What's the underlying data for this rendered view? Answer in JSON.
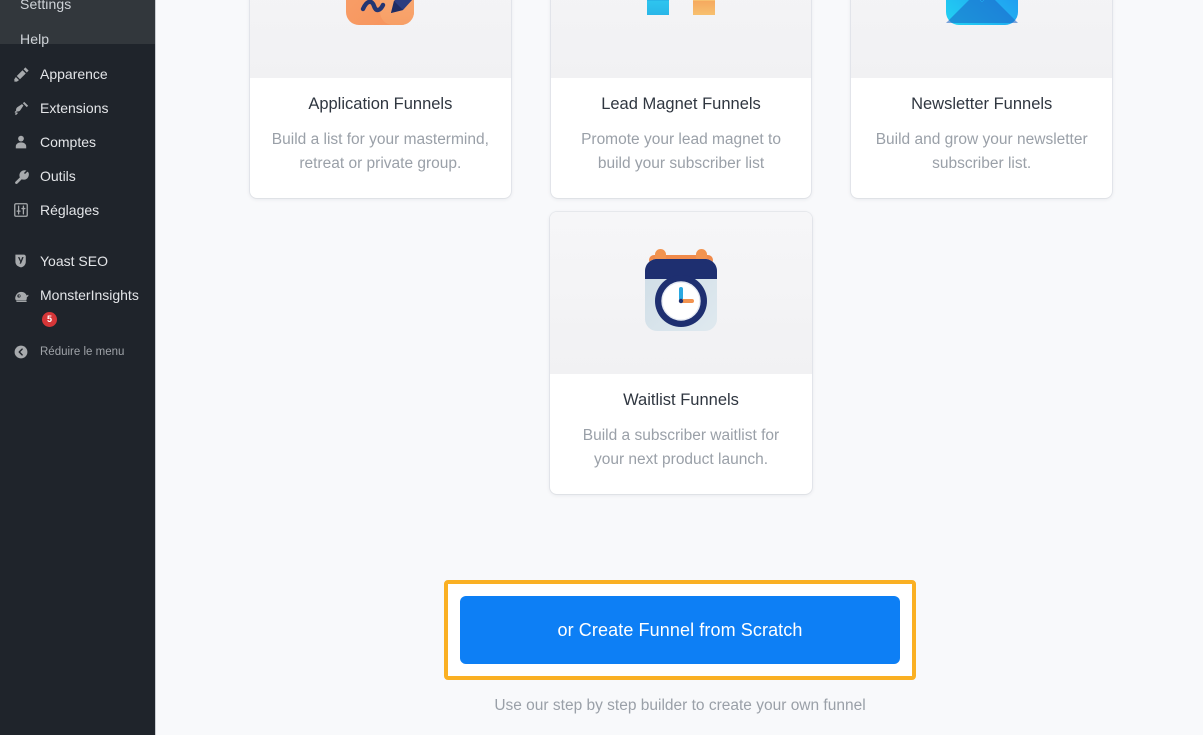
{
  "sidebar": {
    "submenu": [
      {
        "label": "Settings",
        "icon": "none"
      },
      {
        "label": "Help",
        "icon": "none"
      }
    ],
    "items": [
      {
        "label": "Apparence",
        "icon": "paintbrush-icon"
      },
      {
        "label": "Extensions",
        "icon": "plug-icon"
      },
      {
        "label": "Comptes",
        "icon": "user-icon"
      },
      {
        "label": "Outils",
        "icon": "wrench-icon"
      },
      {
        "label": "Réglages",
        "icon": "sliders-icon"
      }
    ],
    "plugins": [
      {
        "label": "Yoast SEO",
        "icon": "yoast-icon",
        "badge": ""
      },
      {
        "label": "MonsterInsights",
        "icon": "monsterinsights-icon",
        "badge": "5"
      }
    ],
    "collapse": {
      "label": "Réduire le menu",
      "icon": "chevron-left-circle-icon"
    },
    "colors": {
      "background": "#1f242b",
      "submenu_background": "#32373c",
      "badge": "#d63638",
      "text": "#e3e5e8"
    }
  },
  "main": {
    "cards": [
      {
        "title": "Application Funnels",
        "description": "Build a list for your mastermind, retreat or private group.",
        "icon": "application-form-icon"
      },
      {
        "title": "Lead Magnet Funnels",
        "description": "Promote your lead magnet to build your subscriber list",
        "icon": "magnet-icon"
      },
      {
        "title": "Newsletter Funnels",
        "description": "Build and grow your newsletter subscriber list.",
        "icon": "envelope-icon"
      },
      {
        "title": "Waitlist Funnels",
        "description": "Build a subscriber waitlist for your next product launch.",
        "icon": "calendar-clock-icon"
      }
    ],
    "cta": {
      "button_label": "or Create Funnel from Scratch",
      "subtext": "Use our step by step builder to create your own funnel",
      "button_color": "#0d7ff5",
      "highlight_color": "#fab023"
    }
  }
}
